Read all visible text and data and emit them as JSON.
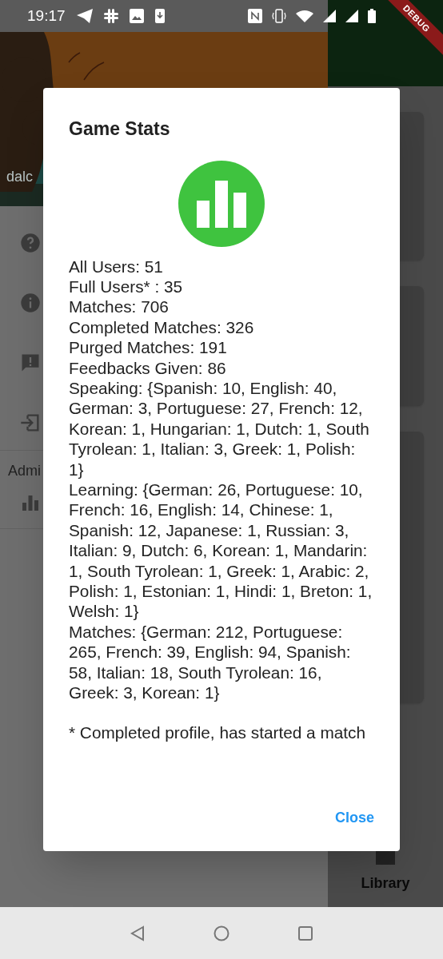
{
  "status_bar": {
    "time": "19:17"
  },
  "debug_banner": {
    "text": "DEBUG"
  },
  "drawer": {
    "header_name": "dalc",
    "section_label": "Admi"
  },
  "right_panel": {
    "tab_label": "Library"
  },
  "dialog": {
    "title": "Game Stats",
    "stats": [
      "All Users: 51",
      "Full Users* : 35",
      "Matches: 706",
      "Completed Matches: 326",
      "Purged Matches: 191",
      "Feedbacks Given: 86",
      "Speaking: {Spanish: 10, English: 40, German: 3, Portuguese: 27, French: 12, Korean: 1, Hungarian: 1, Dutch: 1, South Tyrolean: 1, Italian: 3, Greek: 1, Polish: 1}",
      "Learning: {German: 26, Portuguese: 10, French: 16, English: 14, Chinese: 1, Spanish: 12, Japanese: 1, Russian: 3, Italian: 9, Dutch: 6, Korean: 1, Mandarin: 1, South Tyrolean: 1, Greek: 1, Arabic: 2, Polish: 1, Estonian: 1, Hindi: 1, Breton: 1, Welsh: 1}",
      "Matches: {German: 212, Portuguese: 265, French: 39, English: 94, Spanish: 58, Italian: 18, South Tyrolean: 16, Greek: 3, Korean: 1}"
    ],
    "footnote": "* Completed profile, has started a match",
    "actions": [
      "Close"
    ]
  }
}
